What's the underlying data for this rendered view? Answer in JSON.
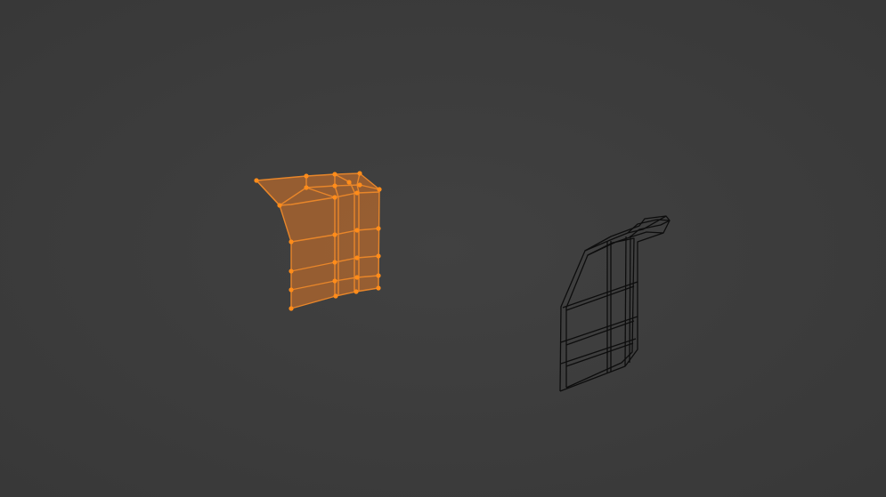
{
  "viewport": {
    "background": "#3d3d3d",
    "mode": "edit"
  },
  "colors": {
    "selected_edge": "#e8862a",
    "selected_vertex": "#ff8c1a",
    "selected_face_fill": "#b8692d",
    "wireframe": "#0d0d0d"
  },
  "objects": [
    {
      "name": "selected-mesh",
      "state": "selected",
      "display": "edit-mode"
    },
    {
      "name": "other-mesh",
      "state": "unselected",
      "display": "wireframe"
    }
  ]
}
